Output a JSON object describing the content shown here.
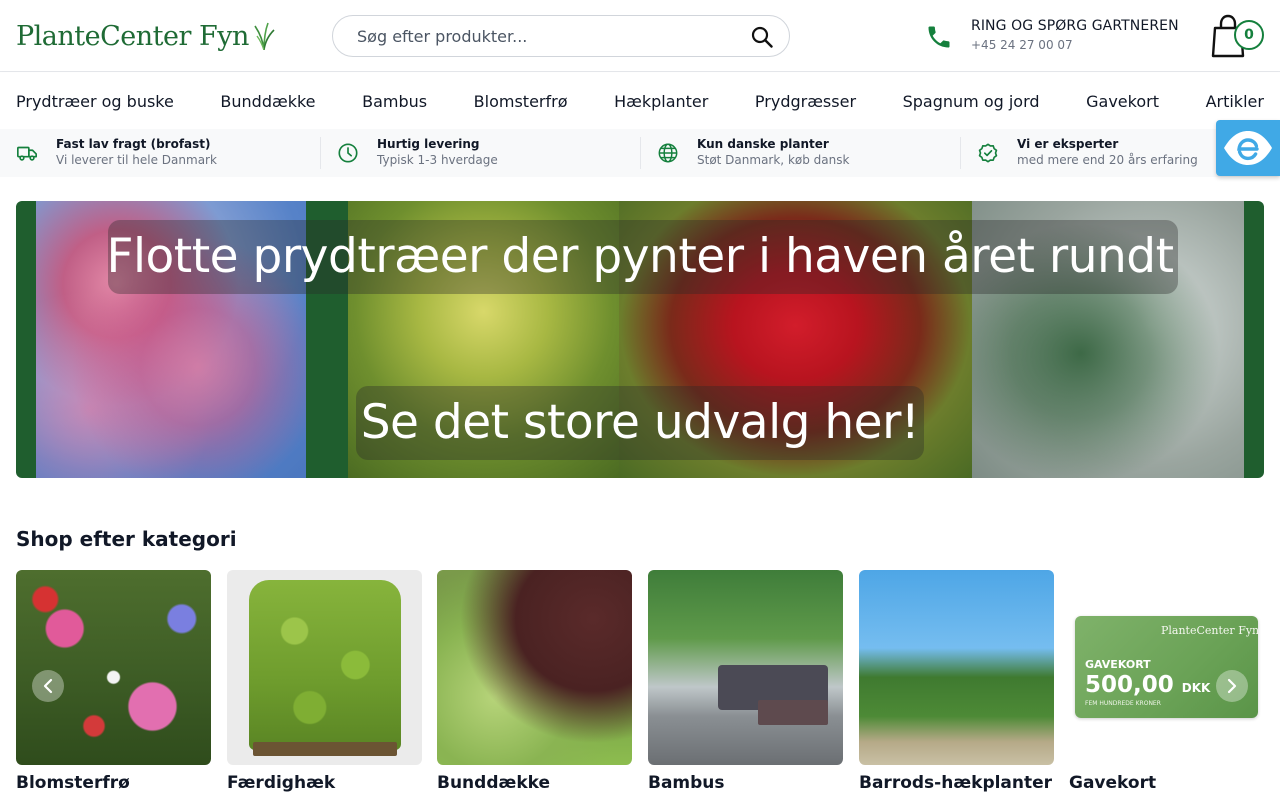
{
  "header": {
    "logo_text": "PlanteCenter Fyn",
    "search": {
      "placeholder": "Søg efter produkter..."
    },
    "phone": {
      "label": "RING OG SPØRG GARTNEREN",
      "number": "+45 24 27 00 07"
    },
    "cart": {
      "count": "0"
    }
  },
  "nav": {
    "items": [
      {
        "label": "Prydtræer og buske"
      },
      {
        "label": "Bunddække"
      },
      {
        "label": "Bambus"
      },
      {
        "label": "Blomsterfrø"
      },
      {
        "label": "Hækplanter"
      },
      {
        "label": "Prydgræsser"
      },
      {
        "label": "Spagnum og jord"
      },
      {
        "label": "Gavekort"
      },
      {
        "label": "Artikler"
      }
    ]
  },
  "usp": [
    {
      "title": "Fast lav fragt (brofast)",
      "subtitle": "Vi leverer til hele Danmark",
      "icon": "truck-icon"
    },
    {
      "title": "Hurtig levering",
      "subtitle": "Typisk 1-3 hverdage",
      "icon": "clock-icon"
    },
    {
      "title": "Kun danske planter",
      "subtitle": "Støt Danmark, køb dansk",
      "icon": "globe-icon"
    },
    {
      "title": "Vi er eksperter",
      "subtitle": "med mere end 20 års erfaring",
      "icon": "badge-check-icon"
    }
  ],
  "hero": {
    "title": "Flotte prydtræer der pynter i haven året rundt",
    "cta": "Se det store udvalg her!"
  },
  "categories": {
    "title": "Shop efter kategori",
    "items": [
      {
        "label": "Blomsterfrø"
      },
      {
        "label": "Færdighæk"
      },
      {
        "label": "Bunddække"
      },
      {
        "label": "Bambus"
      },
      {
        "label": "Barrods-hækplanter"
      },
      {
        "label": "Gavekort"
      }
    ],
    "giftcard": {
      "brand": "PlanteCenter Fyn",
      "kort": "GAVEKORT",
      "amount": "500,00",
      "currency": "DKK",
      "words": "FEM HUNDREDE KRONER"
    }
  },
  "colors": {
    "brand_green": "#15803d",
    "accessibility_blue": "#40a9e6"
  }
}
